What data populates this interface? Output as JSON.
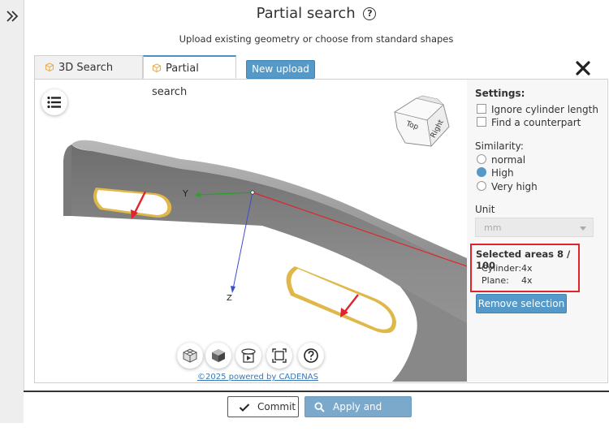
{
  "header": {
    "title": "Partial search",
    "help_glyph": "?",
    "subtitle": "Upload existing geometry or choose from standard shapes"
  },
  "tabs": [
    {
      "label": "3D Search",
      "icon": "cube-icon"
    },
    {
      "label": "Partial search",
      "icon": "cube-icon"
    }
  ],
  "new_upload_label": "New upload",
  "viewer": {
    "axis_y": "Y",
    "axis_z": "Z",
    "navcube": {
      "top": "Top",
      "right": "Right"
    },
    "powered_by": "©2025 powered by CADENAS",
    "toolbar_icons": [
      "wireframe-cube-icon",
      "shaded-cube-icon",
      "rotate-play-icon",
      "fit-view-icon",
      "help-icon"
    ]
  },
  "settings": {
    "heading": "Settings:",
    "checkboxes": [
      {
        "label": "Ignore cylinder length",
        "checked": false
      },
      {
        "label": "Find a counterpart",
        "checked": false
      }
    ],
    "similarity_label": "Similarity:",
    "similarity_options": [
      {
        "label": "normal",
        "selected": false
      },
      {
        "label": "High",
        "selected": true
      },
      {
        "label": "Very high",
        "selected": false
      }
    ],
    "unit_label": "Unit",
    "unit_value": "mm",
    "selected_areas": {
      "heading": "Selected areas 8 / 100",
      "rows": [
        {
          "type": "Cylinder:",
          "count": "4x"
        },
        {
          "type": "Plane:",
          "count": "4x"
        }
      ]
    },
    "remove_selection_label": "Remove selection"
  },
  "footer": {
    "commit_label": "Commit",
    "apply_label": "Apply and search"
  },
  "colors": {
    "accent": "#5499c7",
    "highlight_box": "#e0242b",
    "part": "#8a8a8a"
  }
}
